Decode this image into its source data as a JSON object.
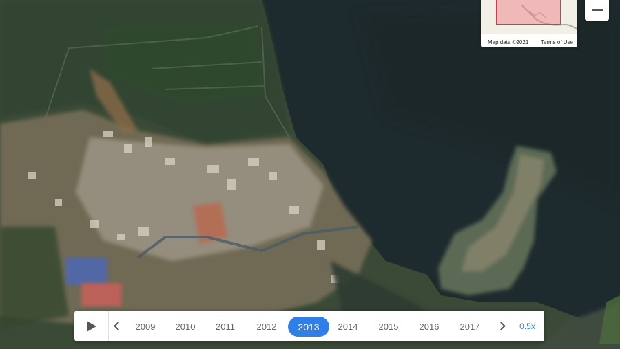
{
  "map": {
    "attribution": "Map data ©2021",
    "terms": "Terms of Use"
  },
  "zoom": {
    "out_label": "−"
  },
  "timeline": {
    "years": [
      "2009",
      "2010",
      "2011",
      "2012",
      "2013",
      "2014",
      "2015",
      "2016",
      "2017"
    ],
    "selected_year": "2013",
    "speed": "0.5x"
  },
  "colors": {
    "accent": "#2f7fe8",
    "water": "#1f2c2f",
    "land": "#3d4d3a"
  }
}
